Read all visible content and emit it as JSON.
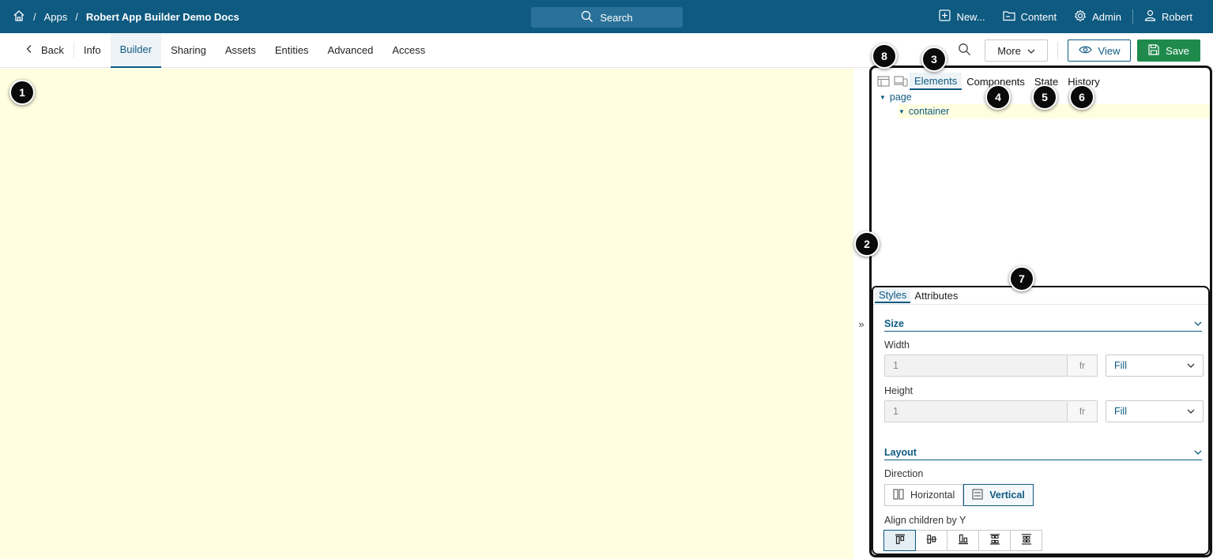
{
  "topbar": {
    "breadcrumb_sep": "/",
    "apps_label": "Apps",
    "app_name": "Robert App Builder Demo Docs",
    "search_label": "Search",
    "new_label": "New...",
    "content_label": "Content",
    "admin_label": "Admin",
    "user_label": "Robert",
    "bg_color": "#0e5a80"
  },
  "subnav": {
    "back_label": "Back",
    "tabs": [
      {
        "label": "Info"
      },
      {
        "label": "Builder",
        "active": true
      },
      {
        "label": "Sharing"
      },
      {
        "label": "Assets"
      },
      {
        "label": "Entities"
      },
      {
        "label": "Advanced"
      },
      {
        "label": "Access"
      }
    ],
    "more_label": "More",
    "view_label": "View",
    "save_label": "Save",
    "save_color": "#1f8a4c"
  },
  "collapse_label": "»",
  "panel": {
    "tabs": [
      {
        "label": "Elements",
        "active": true
      },
      {
        "label": "Components"
      },
      {
        "label": "State"
      },
      {
        "label": "History"
      }
    ],
    "tree": {
      "root": "page",
      "child": "container"
    }
  },
  "styles": {
    "tabs": [
      {
        "label": "Styles",
        "active": true
      },
      {
        "label": "Attributes"
      }
    ],
    "size": {
      "title": "Size",
      "width_label": "Width",
      "width_value": "1",
      "width_unit": "fr",
      "width_mode": "Fill",
      "height_label": "Height",
      "height_value": "1",
      "height_unit": "fr",
      "height_mode": "Fill"
    },
    "layout": {
      "title": "Layout",
      "direction_label": "Direction",
      "horizontal_label": "Horizontal",
      "vertical_label": "Vertical",
      "align_label": "Align children by Y"
    }
  },
  "markers": [
    "1",
    "2",
    "3",
    "4",
    "5",
    "6",
    "7",
    "8"
  ],
  "canvas_color": "#fffee0"
}
